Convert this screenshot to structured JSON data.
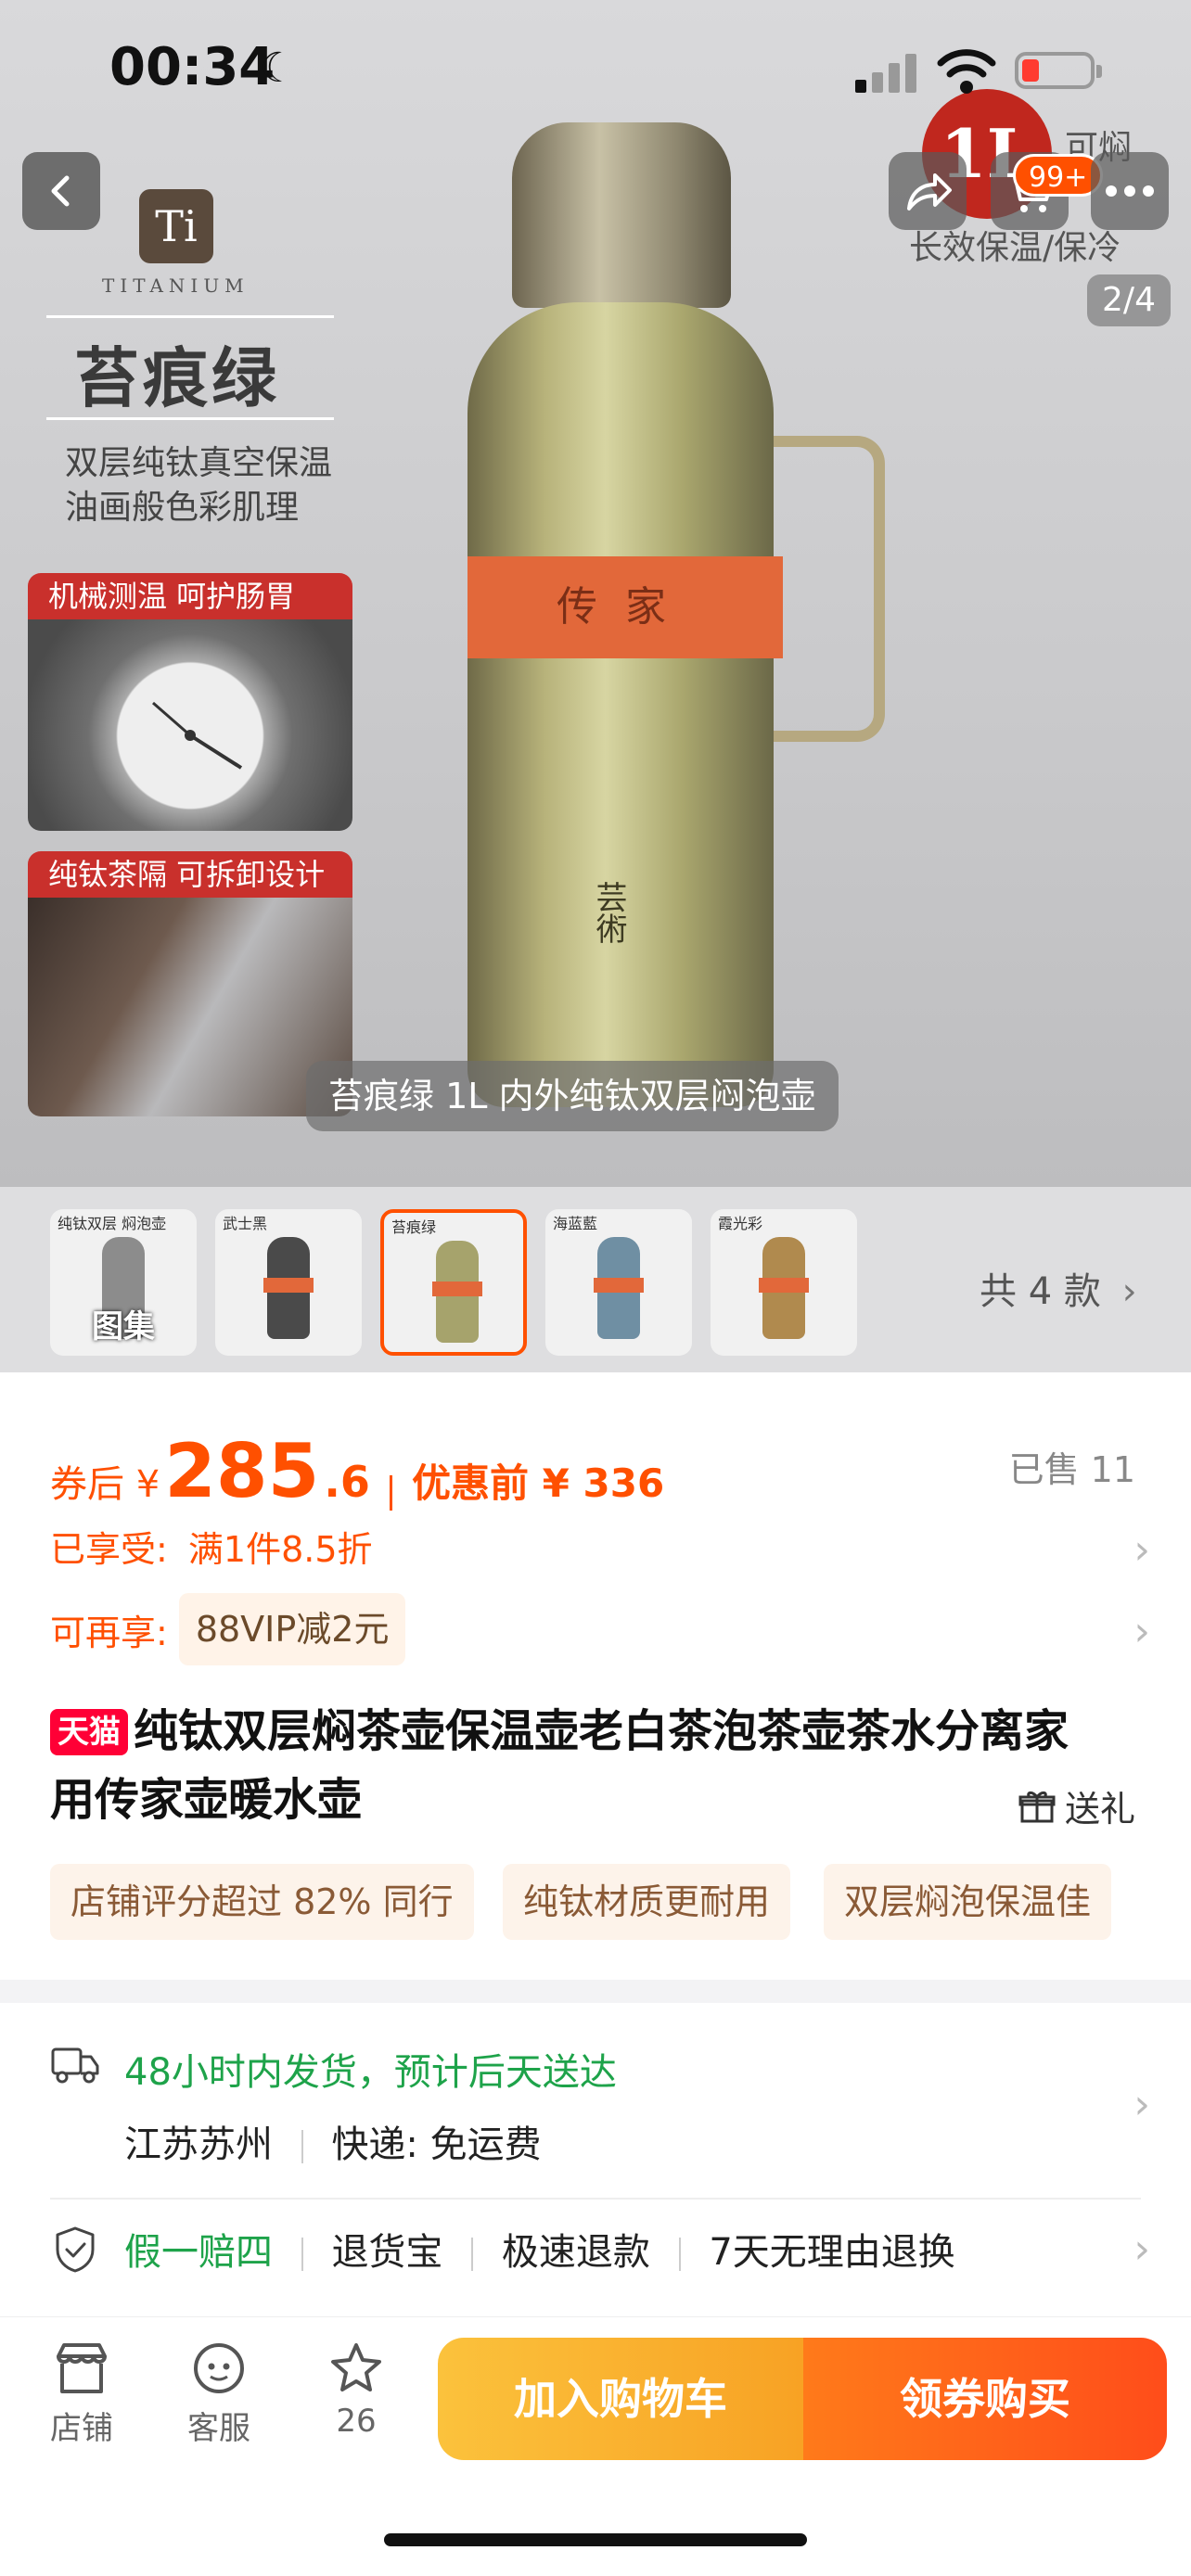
{
  "status_bar": {
    "time": "00:34"
  },
  "hero": {
    "page_indicator": "2/4",
    "cart_badge": "99+",
    "poster": {
      "ti_logo": "Ti",
      "ti_subtitle": "TITANIUM",
      "headline": "苔痕绿",
      "sub1": "双层纯钛真空保温",
      "sub2": "油画般色彩肌理",
      "feature1": "机械测温 呵护肠胃",
      "feature2": "纯钛茶隔 可拆卸设计",
      "volume": "1L",
      "corner_text1": "可焖",
      "corner_text2": "长效保温/保冷",
      "band_text": "传家",
      "bottle_logo": "芸術"
    },
    "caption": "苔痕绿 1L 内外纯钛双层闷泡壶"
  },
  "thumbnails": {
    "items": [
      {
        "label": "图集",
        "mini_text": "纯钛双层 焖泡壶",
        "color": "#8c8c8c"
      },
      {
        "label": "",
        "mini_text": "武士黑",
        "color": "#4a4a4a"
      },
      {
        "label": "",
        "mini_text": "苔痕绿",
        "color": "#a6a36c"
      },
      {
        "label": "",
        "mini_text": "海蓝藍",
        "color": "#6f8fa3"
      },
      {
        "label": "",
        "mini_text": "霞光彩",
        "color": "#b08a4e"
      }
    ],
    "total_styles": "共 4 款"
  },
  "price": {
    "after_coupon_label": "券后 ¥",
    "integer": "285",
    "decimal": ".6",
    "before_label": "优惠前 ¥ 336",
    "sold": "已售 11"
  },
  "promos": {
    "enjoyed_label": "已享受:",
    "enjoyed_value": "满1件8.5折",
    "more_label": "可再享:",
    "more_value": "88VIP减2元"
  },
  "product": {
    "store_badge": "天猫",
    "title": "纯钛双层焖茶壶保温壶老白茶泡茶壶茶水分离家用传家壶暖水壶",
    "gift_label": "送礼"
  },
  "tags": [
    "店铺评分超过 82% 同行",
    "纯钛材质更耐用",
    "双层焖泡保温佳"
  ],
  "shipping": {
    "delivery": "48小时内发货，预计后天送达",
    "origin": "江苏苏州",
    "express": "快递: 免运费"
  },
  "guarantees": {
    "main": "假一赔四",
    "items": [
      "退货宝",
      "极速退款",
      "7天无理由退换"
    ]
  },
  "bottom_bar": {
    "store": "店铺",
    "service": "客服",
    "favorites": "26",
    "add_cart": "加入购物车",
    "buy": "领券购买"
  },
  "colors": {
    "accent": "#ff5000",
    "green": "#1ea34a",
    "tmall_red": "#ff0036"
  }
}
